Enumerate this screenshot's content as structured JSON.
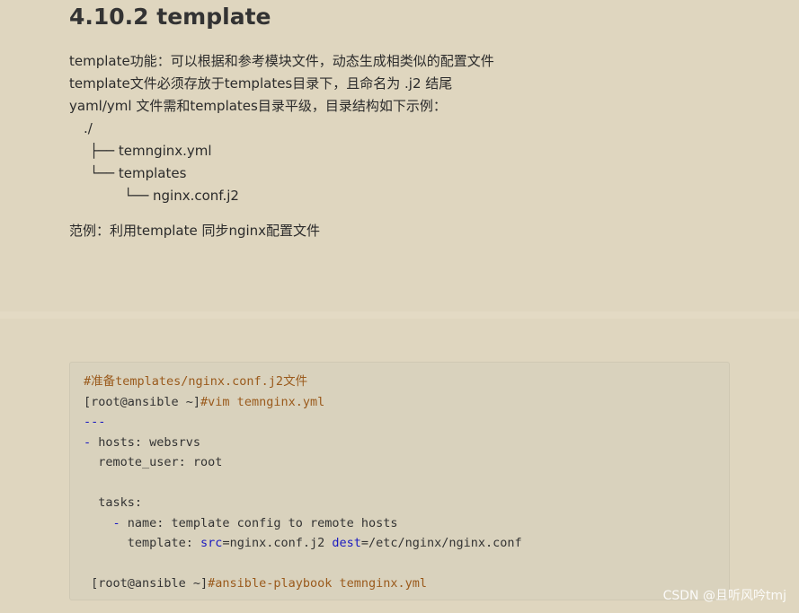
{
  "heading": "4.10.2 template",
  "paragraphs": [
    "template功能：可以根据和参考模块文件，动态生成相类似的配置文件",
    "template文件必须存放于templates目录下，且命名为 .j2 结尾",
    "yaml/yml 文件需和templates目录平级，目录结构如下示例："
  ],
  "tree": [
    "./",
    "├── temnginx.yml",
    "└── templates",
    "        └── nginx.conf.j2"
  ],
  "example": "范例：利用template 同步nginx配置文件",
  "code": {
    "comment": "#准备templates/nginx.conf.j2文件",
    "prompt1": "[root@ansible ~]",
    "cmd1": "#vim temnginx.yml",
    "sep": "---",
    "dash1": "-",
    "hosts": " hosts: websrvs",
    "remote_user": "  remote_user: root",
    "tasks": "  tasks:",
    "dash2": "    -",
    "name": " name: template config to remote hosts",
    "tpl": "      template: ",
    "src_key": "src",
    "src_val": "=nginx.conf.j2 ",
    "dest_key": "dest",
    "dest_val": "=/etc/nginx/nginx.conf",
    "prompt2": " [root@ansible ~]",
    "cmd2": "#ansible-playbook temnginx.yml"
  },
  "watermark": "CSDN @且听风吟tmj"
}
